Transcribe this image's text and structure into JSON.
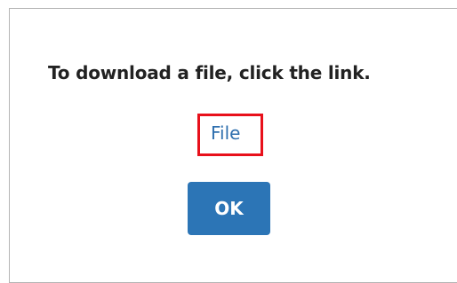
{
  "dialog": {
    "message": "To download a file, click the link.",
    "link_label": "File",
    "ok_label": "OK"
  },
  "colors": {
    "link": "#2e6fae",
    "highlight_box": "#e8101b",
    "ok_button": "#2c75b6",
    "border": "#b5b5b5"
  }
}
